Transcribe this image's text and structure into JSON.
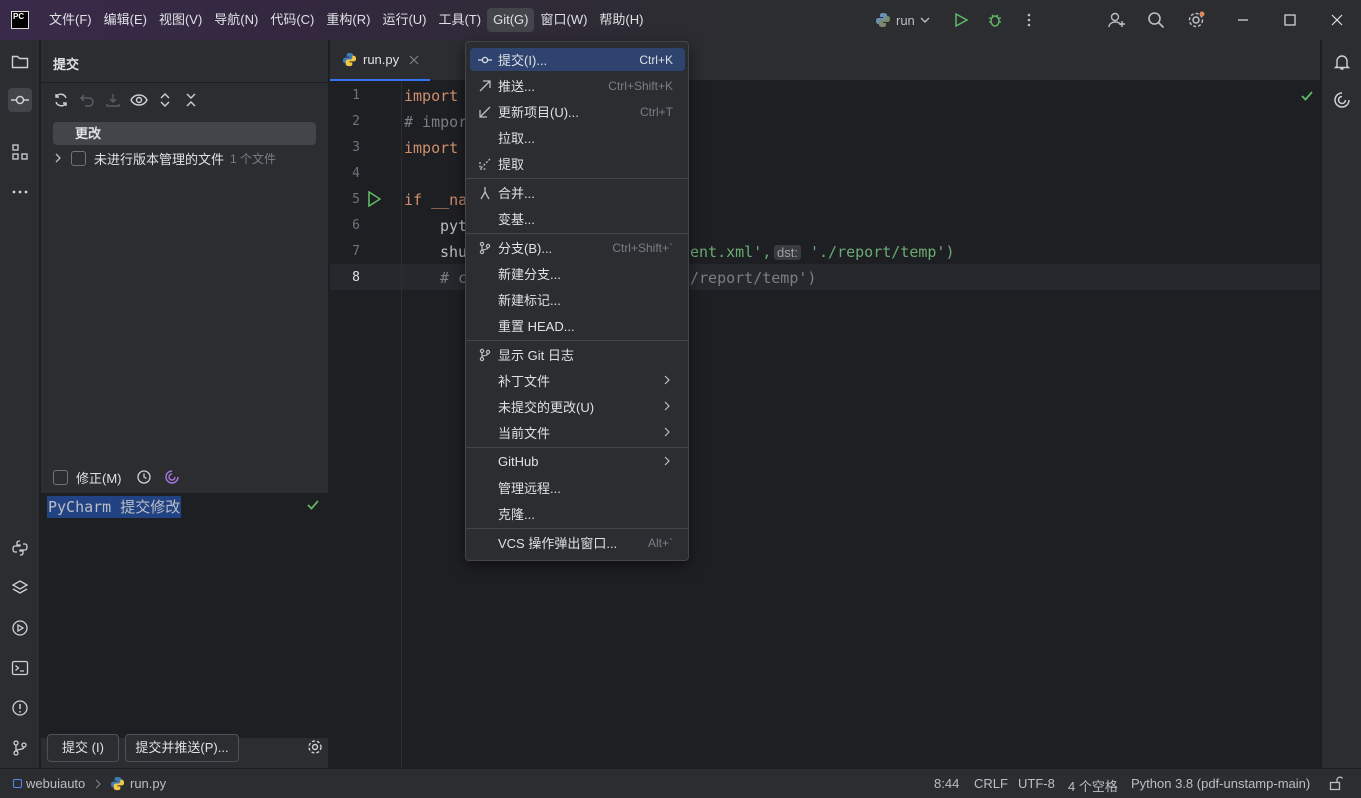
{
  "menubar": {
    "items": [
      "文件(F)",
      "编辑(E)",
      "视图(V)",
      "导航(N)",
      "代码(C)",
      "重构(R)",
      "运行(U)",
      "工具(T)",
      "Git(G)",
      "窗口(W)",
      "帮助(H)"
    ]
  },
  "logo": "PC",
  "run_config": {
    "name": "run"
  },
  "commit_panel": {
    "title": "提交",
    "changes_label": "更改",
    "unversioned_label": "未进行版本管理的文件",
    "unversioned_count": "1 个文件",
    "amend_label": "修正(M)",
    "message": "PyCharm 提交修改",
    "commit_button": "提交 (I)",
    "commit_push_button": "提交并推送(P)..."
  },
  "editor": {
    "tab_name": "run.py",
    "line_numbers": [
      "1",
      "2",
      "3",
      "4",
      "5",
      "6",
      "7",
      "8"
    ],
    "lines": {
      "l1": "import",
      "l2": "# impor",
      "l3": "import",
      "l5": "if __na",
      "l6": "pyt",
      "l7a": "shu",
      "l7b": "ent.xml',",
      "l7hint": "dst:",
      "l7c": "'./report/temp')",
      "l8a": "# c",
      "l8b": "/report/temp')"
    }
  },
  "git_menu": {
    "items": [
      {
        "label": "提交(I)...",
        "shortcut": "Ctrl+K"
      },
      {
        "label": "推送...",
        "shortcut": "Ctrl+Shift+K"
      },
      {
        "label": "更新项目(U)...",
        "shortcut": "Ctrl+T"
      },
      {
        "label": "拉取...",
        "shortcut": ""
      },
      {
        "label": "提取",
        "shortcut": ""
      },
      {
        "label": "合并...",
        "shortcut": ""
      },
      {
        "label": "变基...",
        "shortcut": ""
      },
      {
        "label": "分支(B)...",
        "shortcut": "Ctrl+Shift+`"
      },
      {
        "label": "新建分支...",
        "shortcut": ""
      },
      {
        "label": "新建标记...",
        "shortcut": ""
      },
      {
        "label": "重置 HEAD...",
        "shortcut": ""
      },
      {
        "label": "显示 Git 日志",
        "shortcut": ""
      },
      {
        "label": "补丁文件",
        "shortcut": ""
      },
      {
        "label": "未提交的更改(U)",
        "shortcut": ""
      },
      {
        "label": "当前文件",
        "shortcut": ""
      },
      {
        "label": "GitHub",
        "shortcut": ""
      },
      {
        "label": "管理远程...",
        "shortcut": ""
      },
      {
        "label": "克隆...",
        "shortcut": ""
      },
      {
        "label": "VCS 操作弹出窗口...",
        "shortcut": "Alt+`"
      }
    ]
  },
  "statusbar": {
    "project": "webuiauto",
    "file": "run.py",
    "position": "8:44",
    "line_sep": "CRLF",
    "encoding": "UTF-8",
    "indent": "4 个空格",
    "interpreter": "Python 3.8 (pdf-unstamp-main)"
  },
  "colors": {
    "accent": "#3574f0",
    "selection": "#2e436e",
    "ok_green": "#5fb865",
    "python_blue": "#3d7ab8",
    "python_yellow": "#f5c842"
  }
}
